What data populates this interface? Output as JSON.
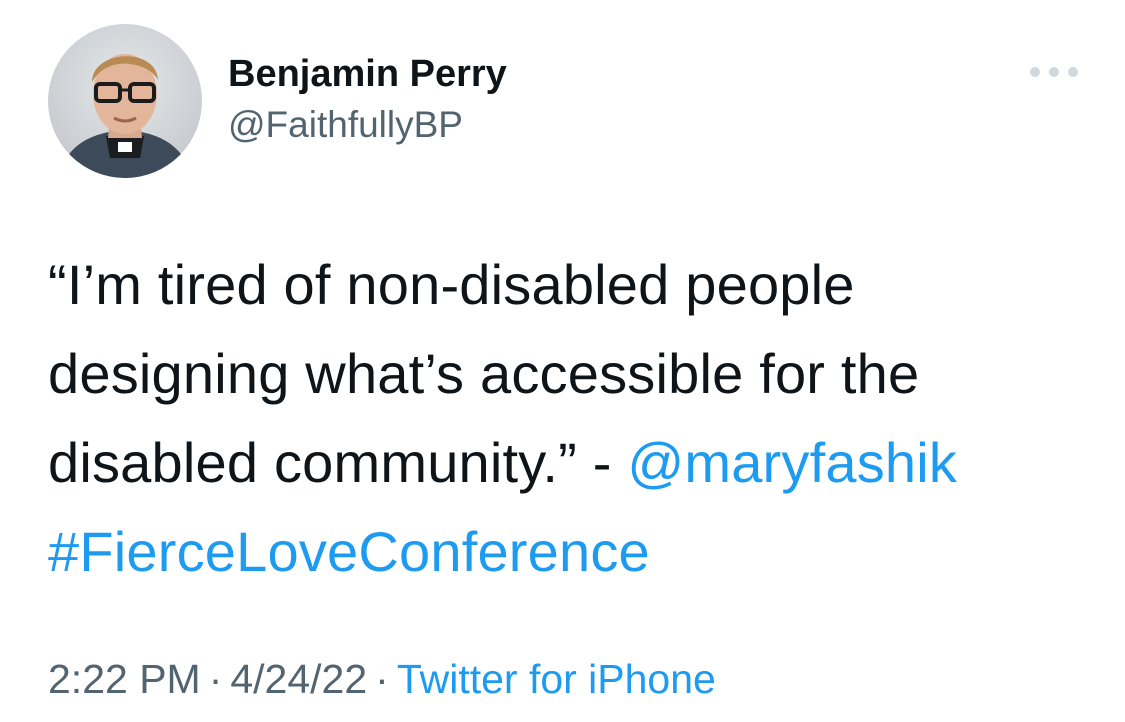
{
  "author": {
    "display_name": "Benjamin Perry",
    "handle": "@FaithfullyBP",
    "avatar_icon": "user-avatar-photo"
  },
  "more_icon": "more-horizontal-icon",
  "tweet": {
    "line1": "“I’m tired of non-disabled people",
    "line2": "designing what’s accessible for the",
    "line3_text": "disabled community.” - ",
    "mention": "@maryfashik",
    "hashtag": "#FierceLoveConference"
  },
  "meta": {
    "time": "2:22 PM",
    "date": "4/24/22",
    "separator": "·",
    "source": "Twitter for iPhone"
  },
  "colors": {
    "link": "#1d9bf0",
    "text": "#0f1419",
    "secondary": "#536471"
  }
}
